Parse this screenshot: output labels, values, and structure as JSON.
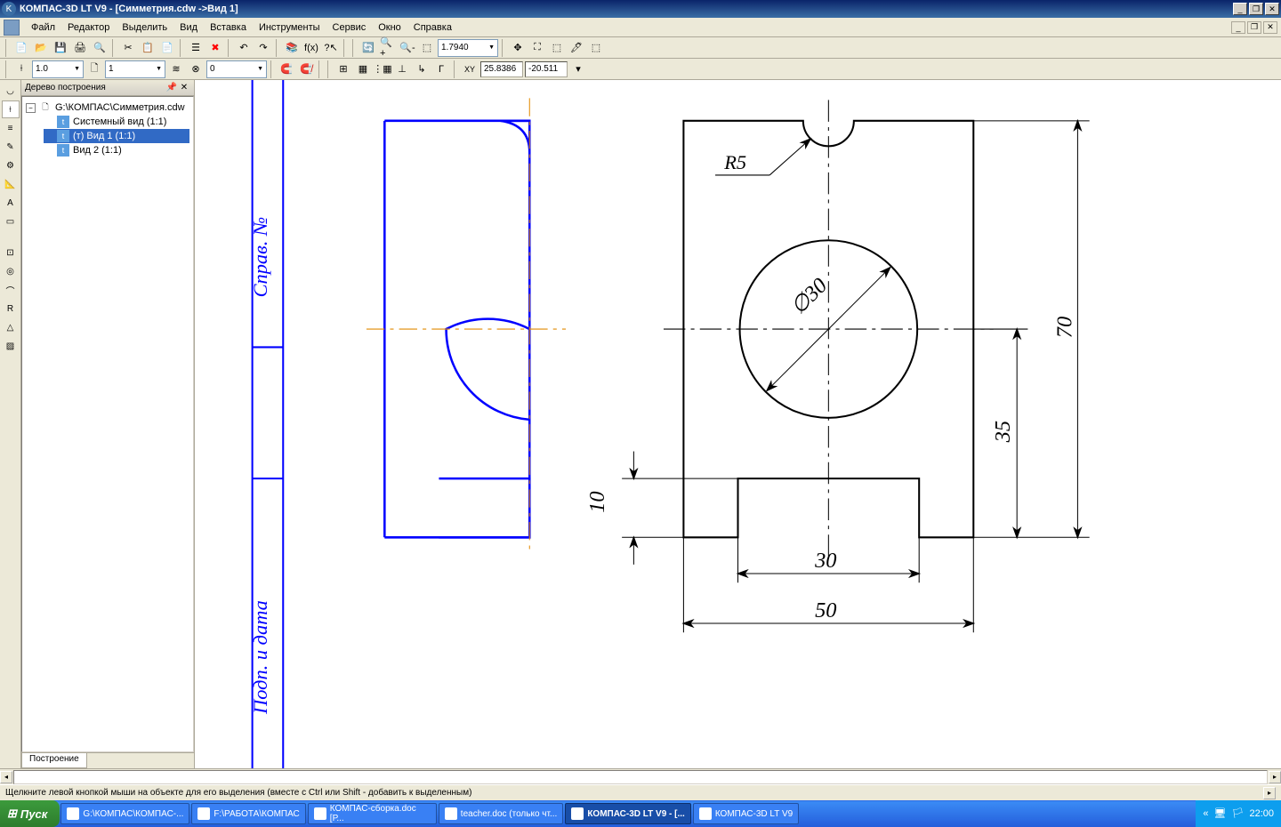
{
  "title_bar": {
    "app_title": "КОМПАС-3D LT V9 - [Симметрия.cdw ->Вид 1]"
  },
  "menu": {
    "file": "Файл",
    "edit": "Редактор",
    "select": "Выделить",
    "view": "Вид",
    "insert": "Вставка",
    "tools": "Инструменты",
    "service": "Сервис",
    "window": "Окно",
    "help": "Справка"
  },
  "toolbar1": {
    "zoom_value": "1.7940"
  },
  "toolbar2": {
    "scale": "1.0",
    "layer": "1",
    "style": "0",
    "coord_label": "XY",
    "coord_x": "25.8386",
    "coord_y": "-20.511"
  },
  "tree": {
    "title": "Дерево построения",
    "root": "G:\\КОМПАС\\Симметрия.cdw",
    "items": [
      "Системный вид (1:1)",
      "(т) Вид 1 (1:1)",
      "Вид 2 (1:1)"
    ],
    "tab": "Построение"
  },
  "canvas": {
    "label_spravno": "Справ. №",
    "label_podpdata": "Подп. и дата",
    "dim_r5": "R5",
    "dim_d30": "∅30",
    "dim_70": "70",
    "dim_35": "35",
    "dim_10": "10",
    "dim_30w": "30",
    "dim_50": "50"
  },
  "status": {
    "hint": "Щелкните левой кнопкой мыши на объекте для его выделения (вместе с Ctrl или Shift - добавить к выделенным)"
  },
  "taskbar": {
    "start": "Пуск",
    "items": [
      "G:\\КОМПАС\\КОМПАС-...",
      "F:\\РАБОТА\\КОМПАС",
      "КОМПАС-сборка.doc [Р...",
      "teacher.doc (только чт...",
      "КОМПАС-3D LT V9 - [...",
      "КОМПАС-3D LT V9"
    ],
    "clock": "22:00"
  }
}
